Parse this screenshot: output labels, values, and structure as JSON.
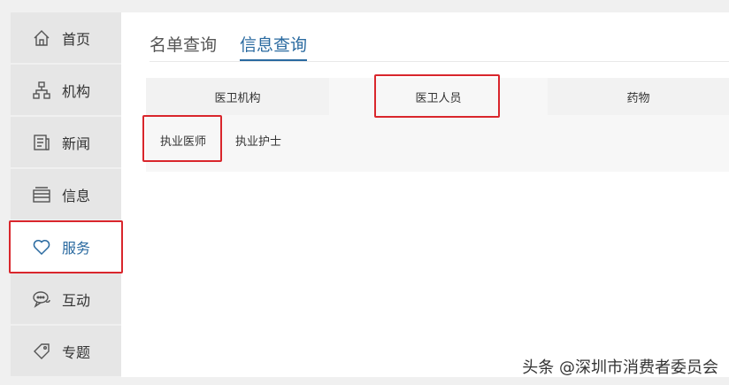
{
  "sidebar": {
    "items": [
      {
        "label": "首页",
        "icon": "home-icon"
      },
      {
        "label": "机构",
        "icon": "org-chart-icon"
      },
      {
        "label": "新闻",
        "icon": "news-icon"
      },
      {
        "label": "信息",
        "icon": "layers-icon"
      },
      {
        "label": "服务",
        "icon": "heart-icon",
        "active": true
      },
      {
        "label": "互动",
        "icon": "chat-icon"
      },
      {
        "label": "专题",
        "icon": "tag-icon"
      }
    ]
  },
  "main": {
    "tabs": [
      {
        "label": "名单查询"
      },
      {
        "label": "信息查询",
        "active": true
      }
    ],
    "categories": [
      {
        "label": "医卫机构"
      },
      {
        "label": "医卫人员",
        "selected": true
      },
      {
        "label": "药物"
      }
    ],
    "subcategories": [
      {
        "label": "执业医师",
        "selected": true
      },
      {
        "label": "执业护士"
      }
    ]
  },
  "watermark": "头条 @深圳市消费者委员会",
  "colors": {
    "accent": "#2a6aa0",
    "highlight": "#d9262c",
    "sidebar_bg": "#e6e6e6"
  }
}
